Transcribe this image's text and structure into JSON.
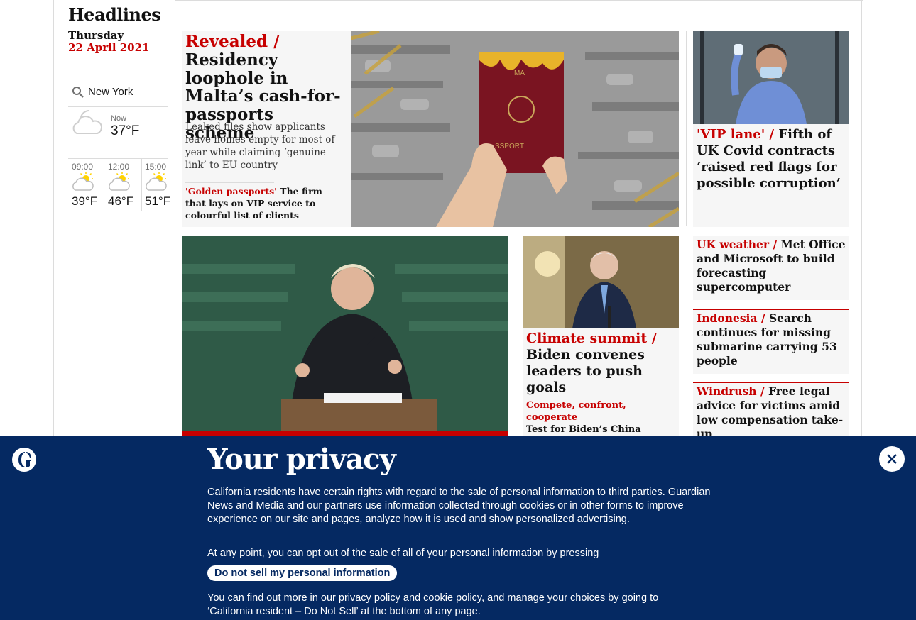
{
  "sidebar": {
    "title": "Headlines",
    "day": "Thursday",
    "date": "22 April 2021",
    "location": "New York",
    "now_label": "Now",
    "now_temp": "37°F",
    "forecast": [
      {
        "time": "09:00",
        "temp": "39°F"
      },
      {
        "time": "12:00",
        "temp": "46°F"
      },
      {
        "time": "15:00",
        "temp": "51°F"
      }
    ]
  },
  "main_story": {
    "kicker": "Revealed /",
    "headline": "Residency loophole in Malta’s cash-for-passports scheme",
    "standfirst": "Leaked files show applicants leave homes empty for most of year while claiming ‘genuine link’ to EU country",
    "sub_kicker": "'Golden passports'",
    "sub_text": "The firm that lays on VIP service to colourful list of clients",
    "image_text_top": "MA",
    "image_text_bottom": "SSPORT"
  },
  "side_story": {
    "kicker": "'VIP lane' /",
    "headline": "Fifth of UK Covid contracts ‘raised red flags for possible corruption’"
  },
  "biden_story": {
    "kicker": "Climate summit /",
    "headline": "Biden convenes leaders to push goals",
    "sub_kicker": "Compete, confront, cooperate",
    "sub_text": "Test for Biden’s China watchwords"
  },
  "small_stories": [
    {
      "kicker": "UK weather /",
      "headline": "Met Office and Microsoft to build forecasting supercomputer"
    },
    {
      "kicker": "Indonesia /",
      "headline": "Search continues for missing submarine carrying 53 people"
    },
    {
      "kicker": "Windrush /",
      "headline": "Free legal advice for victims amid low compensation take-up"
    }
  ],
  "privacy": {
    "title": "Your privacy",
    "para1": "California residents have certain rights with regard to the sale of personal information to third parties. Guardian News and Media and our partners use information collected through cookies or in other forms to improve experience on our site and pages, analyze how it is used and show personalized advertising.",
    "para2": "At any point, you can opt out of the sale of all of your personal information by pressing",
    "button": "Do not sell my personal information",
    "para3_a": "You can find out more in our ",
    "privacy_link": "privacy policy",
    "para3_b": " and ",
    "cookie_link": "cookie policy",
    "para3_c": ", and manage your choices by going to ‘California resident – Do Not Sell’ at the bottom of any page."
  },
  "colors": {
    "brand_blue": "#052962",
    "red": "#c70000",
    "panel": "#f6f6f6"
  },
  "icons": [
    "search-icon",
    "cloud-icon",
    "sun-cloud-icon",
    "guardian-logo-icon",
    "close-icon"
  ]
}
